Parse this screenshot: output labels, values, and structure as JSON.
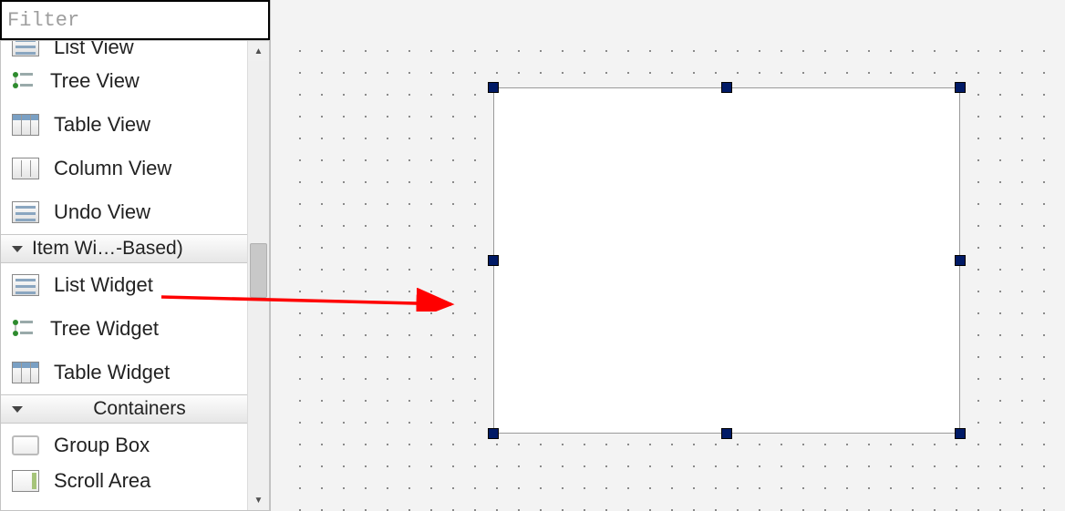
{
  "filter": {
    "placeholder": "Filter"
  },
  "widgetbox": {
    "section_itemviews_partial_label": "List View",
    "itemviews": [
      {
        "label": "Tree View",
        "icon": "tree"
      },
      {
        "label": "Table View",
        "icon": "table"
      },
      {
        "label": "Column View",
        "icon": "columns"
      },
      {
        "label": "Undo View",
        "icon": "list"
      }
    ],
    "section_itemwidgets_label": "Item Wi…-Based)",
    "itemwidgets": [
      {
        "label": "List Widget",
        "icon": "list"
      },
      {
        "label": "Tree Widget",
        "icon": "tree"
      },
      {
        "label": "Table Widget",
        "icon": "table"
      }
    ],
    "section_containers_label": "Containers",
    "containers": [
      {
        "label": "Group Box",
        "icon": "groupbox"
      },
      {
        "label": "Scroll Area",
        "icon": "scrollarea"
      }
    ]
  },
  "annotation": {
    "arrow_color": "#ff0000"
  },
  "canvas": {
    "selected_widget": "List Widget",
    "handle_color": "#001a66"
  }
}
